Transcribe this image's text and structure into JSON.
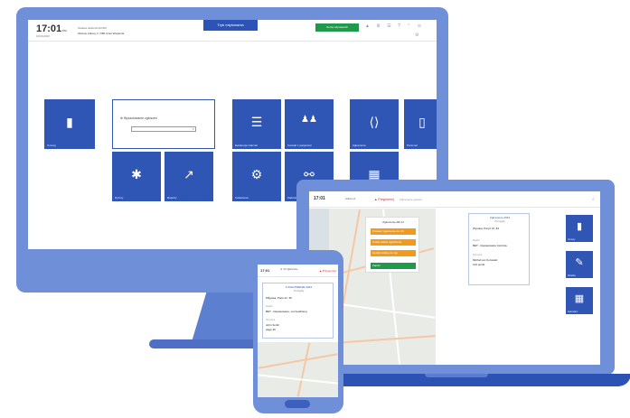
{
  "monitor": {
    "time": "17:01",
    "time_suffix": "PM",
    "date": "10/11/2023",
    "header_line1": "Ustawa Janiki ALLFORI",
    "header_line2": "Główne Adresy   1 / 680   Czas Wsparcia",
    "top_tab": "Tryb edytowania",
    "green_button": "Sortuj odpowiedzi",
    "header_icons": "▲ ⚙ ☰ ? ⌃ ⊙",
    "gear": "⚙",
    "search_panel": {
      "label": "Wyszukiwanie zgłoszeń",
      "placeholder": ""
    },
    "tiles": [
      {
        "label": "Umowy",
        "icon": "▮"
      },
      {
        "label": "Ewidencja zdarzeń",
        "icon": "☰"
      },
      {
        "label": "Kontakt z pacjentem",
        "icon": "♟♟"
      },
      {
        "label": "Zgłoszenia",
        "icon": "⟨⟩"
      },
      {
        "label": "Personel",
        "icon": "▯"
      },
      {
        "label": "Dyżury",
        "icon": "✱"
      },
      {
        "label": "Raporty",
        "icon": "↗"
      },
      {
        "label": "Ustawienia",
        "icon": "⚙"
      },
      {
        "label": "Zadania",
        "icon": "⚯"
      },
      {
        "label": "Terminarz",
        "icon": "▦"
      }
    ]
  },
  "laptop": {
    "time": "17:01",
    "address": "Adres ul.",
    "nav": "▲ Przypomnij",
    "message": "Zgłoszenie gotowe",
    "popup": {
      "title": "Zgłoszenie AB-14",
      "actions": [
        "Przekaż zgłoszenie do ZS",
        "Zmień status zgłoszenia",
        "Dodaj notatkę do zgł.",
        "Zapisz"
      ]
    },
    "card": {
      "title": "Zgłoszenie 2023",
      "subtitle": "Szczegóły",
      "address": "Wysoka, Paryż dz. 84",
      "field1_label": "Pojazd",
      "field1_value": "BET - Dopasowane zwrotnie",
      "field2_label": "Kierowca",
      "field2_value": "Michał von Kurowski",
      "field2_extra": "123 punkt"
    },
    "side_tiles": [
      {
        "label": "Umowy",
        "icon": "▮"
      },
      {
        "label": "Notatka",
        "icon": "✎"
      },
      {
        "label": "Kalendarz",
        "icon": "▦"
      }
    ]
  },
  "phone": {
    "time": "17:01",
    "address": "ul. XX Zgłoszenie",
    "nav": "▲ Przypomnij",
    "card": {
      "title": "# ZGŁOSZENIE 2023",
      "subtitle": "Szczegóły",
      "address": "Wilgowa, Paris dz. 36",
      "field1_label": "Pojazd",
      "field1_value": "BET - Dopasowane, not bestFleng",
      "field2_label": "Kierowca",
      "field2_value": "John Smith",
      "field2_extra": "page 46"
    }
  }
}
